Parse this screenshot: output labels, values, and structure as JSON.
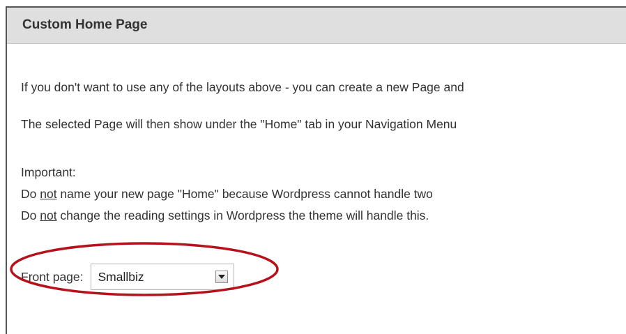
{
  "panel": {
    "title": "Custom Home Page"
  },
  "paragraphs": {
    "p1": "If you don't want to use any of the layouts above - you can create a new Page and",
    "p2": "The selected Page will then show under the \"Home\" tab in your Navigation Menu"
  },
  "important": {
    "heading": "Important:",
    "line1_pre": "Do ",
    "line1_em": "not",
    "line1_post": " name your new page \"Home\" because Wordpress cannot handle two",
    "line2_pre": "Do ",
    "line2_em": "not",
    "line2_post": " change the reading settings in Wordpress the theme will handle this."
  },
  "front_page": {
    "label": "Front page:",
    "selected": "Smallbiz"
  },
  "colors": {
    "highlight": "#b5121b",
    "header_bg": "#dfdfdf"
  },
  "icons": {
    "dropdown": "chevron-down-icon"
  }
}
